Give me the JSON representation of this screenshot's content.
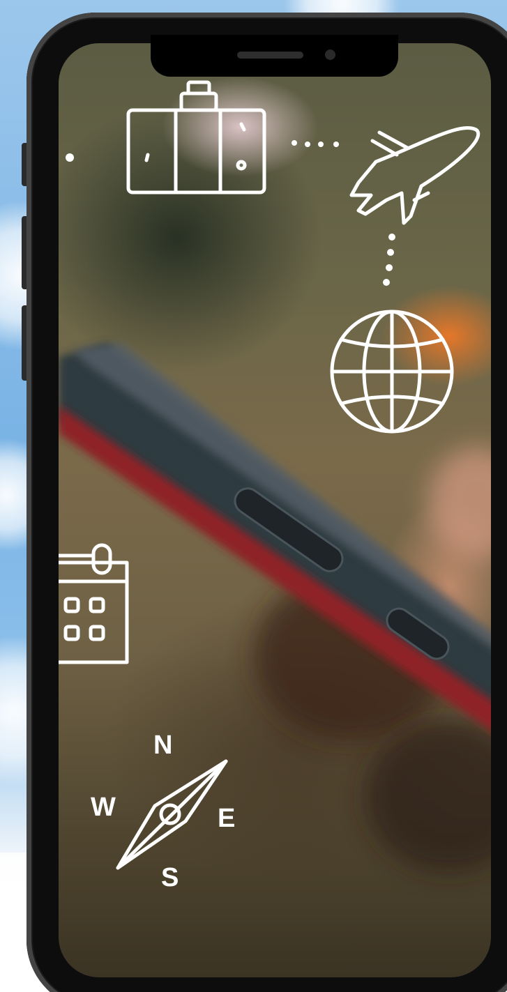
{
  "compass": {
    "north": "N",
    "east": "E",
    "west": "W",
    "south": "S"
  },
  "colors": {
    "sky": "#79b3e5",
    "phone_body": "#0d0d0d",
    "doodle": "#ffffff",
    "screen_warm": "#7a6a4a",
    "accent_orange": "#eb7828"
  },
  "icons": [
    "suitcase-icon",
    "airplane-icon",
    "globe-icon",
    "calendar-icon",
    "compass-icon"
  ]
}
